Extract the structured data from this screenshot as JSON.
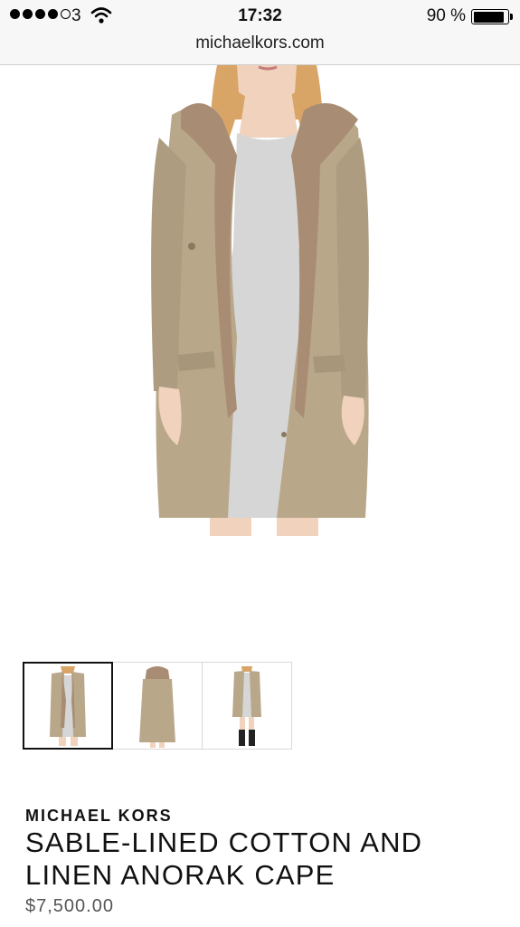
{
  "status_bar": {
    "carrier": "3",
    "time": "17:32",
    "battery_percent": "90 %",
    "battery_level": 0.9,
    "signal_bars_filled": 4,
    "signal_bars_total": 5
  },
  "browser": {
    "url": "michaelkors.com"
  },
  "product": {
    "main_image_icon": "coat-model-photo",
    "thumbnails": [
      {
        "icon": "coat-front-thumbnail",
        "selected": true
      },
      {
        "icon": "coat-back-thumbnail",
        "selected": false
      },
      {
        "icon": "coat-full-length-thumbnail",
        "selected": false
      }
    ],
    "brand": "MICHAEL KORS",
    "title": "SABLE-LINED COTTON AND LINEN ANORAK CAPE",
    "price": "$7,500.00"
  },
  "colors": {
    "coat": "#b9a78a",
    "fur": "#a88d74",
    "dress": "#d6d6d6",
    "skin": "#f0d2bd",
    "hair": "#d9a566"
  }
}
